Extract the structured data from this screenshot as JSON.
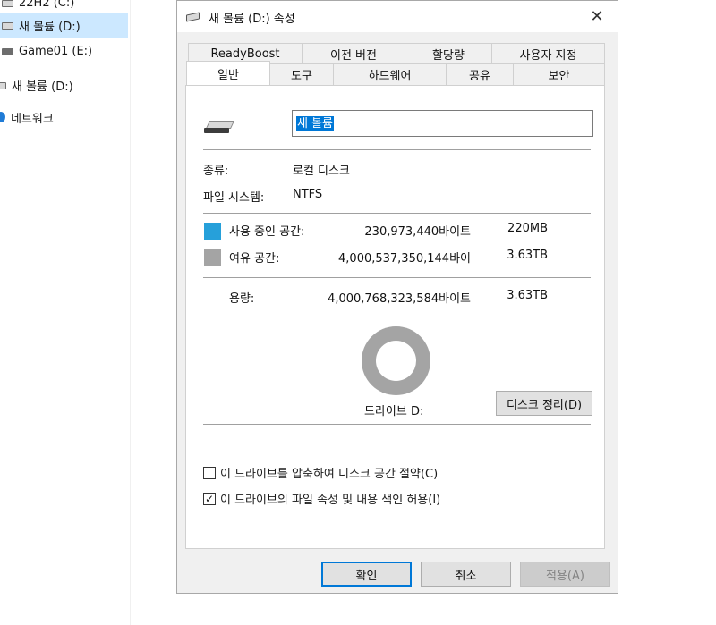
{
  "sidebar": {
    "items": [
      {
        "label": "22H2 (C:)",
        "icon": "drive-icon",
        "selected": false
      },
      {
        "label": "새 볼륨 (D:)",
        "icon": "drive-icon",
        "selected": true
      },
      {
        "label": "Game01 (E:)",
        "icon": "drive-icon",
        "selected": false
      },
      {
        "label": "새 볼륨 (D:)",
        "icon": "drive-icon",
        "selected": false
      },
      {
        "label": "네트워크",
        "icon": "network-icon",
        "selected": false
      }
    ]
  },
  "dialog": {
    "title": "새 볼륨 (D:) 속성",
    "close_glyph": "✕",
    "tabs_row1": [
      "ReadyBoost",
      "이전 버전",
      "할당량",
      "사용자 지정"
    ],
    "tabs_row2": [
      "일반",
      "도구",
      "하드웨어",
      "공유",
      "보안"
    ],
    "active_tab": "일반",
    "general": {
      "volume_name": "새 볼륨",
      "type_label": "종류:",
      "type_value": "로컬 디스크",
      "fs_label": "파일 시스템:",
      "fs_value": "NTFS",
      "used_label": "사용 중인 공간:",
      "used_bytes": "230,973,440바이트",
      "used_size": "220MB",
      "used_color": "#26a0da",
      "free_label": "여유 공간:",
      "free_bytes": "4,000,537,350,144바이",
      "free_size": "3.63TB",
      "free_color": "#a4a4a4",
      "capacity_label": "용량:",
      "capacity_bytes": "4,000,768,323,584바이트",
      "capacity_size": "3.63TB",
      "drive_label": "드라이브 D:",
      "cleanup_button": "디스크 정리(D)",
      "compress_label": "이 드라이브를 압축하여 디스크 공간 절약(C)",
      "compress_checked": false,
      "index_label": "이 드라이브의 파일 속성 및 내용 색인 허용(I)",
      "index_checked": true,
      "check_glyph": "✓"
    },
    "buttons": {
      "ok": "확인",
      "cancel": "취소",
      "apply": "적용(A)"
    }
  }
}
